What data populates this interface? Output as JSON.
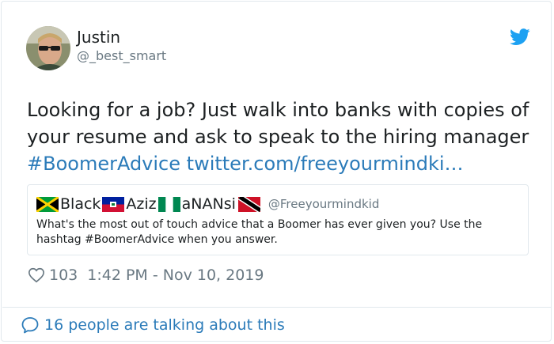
{
  "author": {
    "name": "Justin",
    "handle": "@_best_smart"
  },
  "tweet": {
    "text": "Looking for a job? Just walk into banks with copies of your resume and ask to speak to the hiring manager",
    "hashtag": "#BoomerAdvice",
    "link": "twitter.com/freeyourmindki…"
  },
  "quoted": {
    "name_parts": [
      "Black",
      "Aziz",
      "aNANsi"
    ],
    "flags": [
      "jamaica-flag-icon",
      "haiti-flag-icon",
      "nigeria-flag-icon",
      "trinidad-flag-icon"
    ],
    "handle": "@Freeyourmindkid",
    "text": "What's the most out of touch advice that a Boomer has ever given you? Use the hashtag #BoomerAdvice when you answer."
  },
  "meta": {
    "likes": "103",
    "timestamp": "1:42 PM - Nov 10, 2019"
  },
  "footer": {
    "label": "16 people are talking about this"
  },
  "colors": {
    "link": "#2b7bb9",
    "twitter_blue": "#1da1f2",
    "muted": "#697882"
  }
}
